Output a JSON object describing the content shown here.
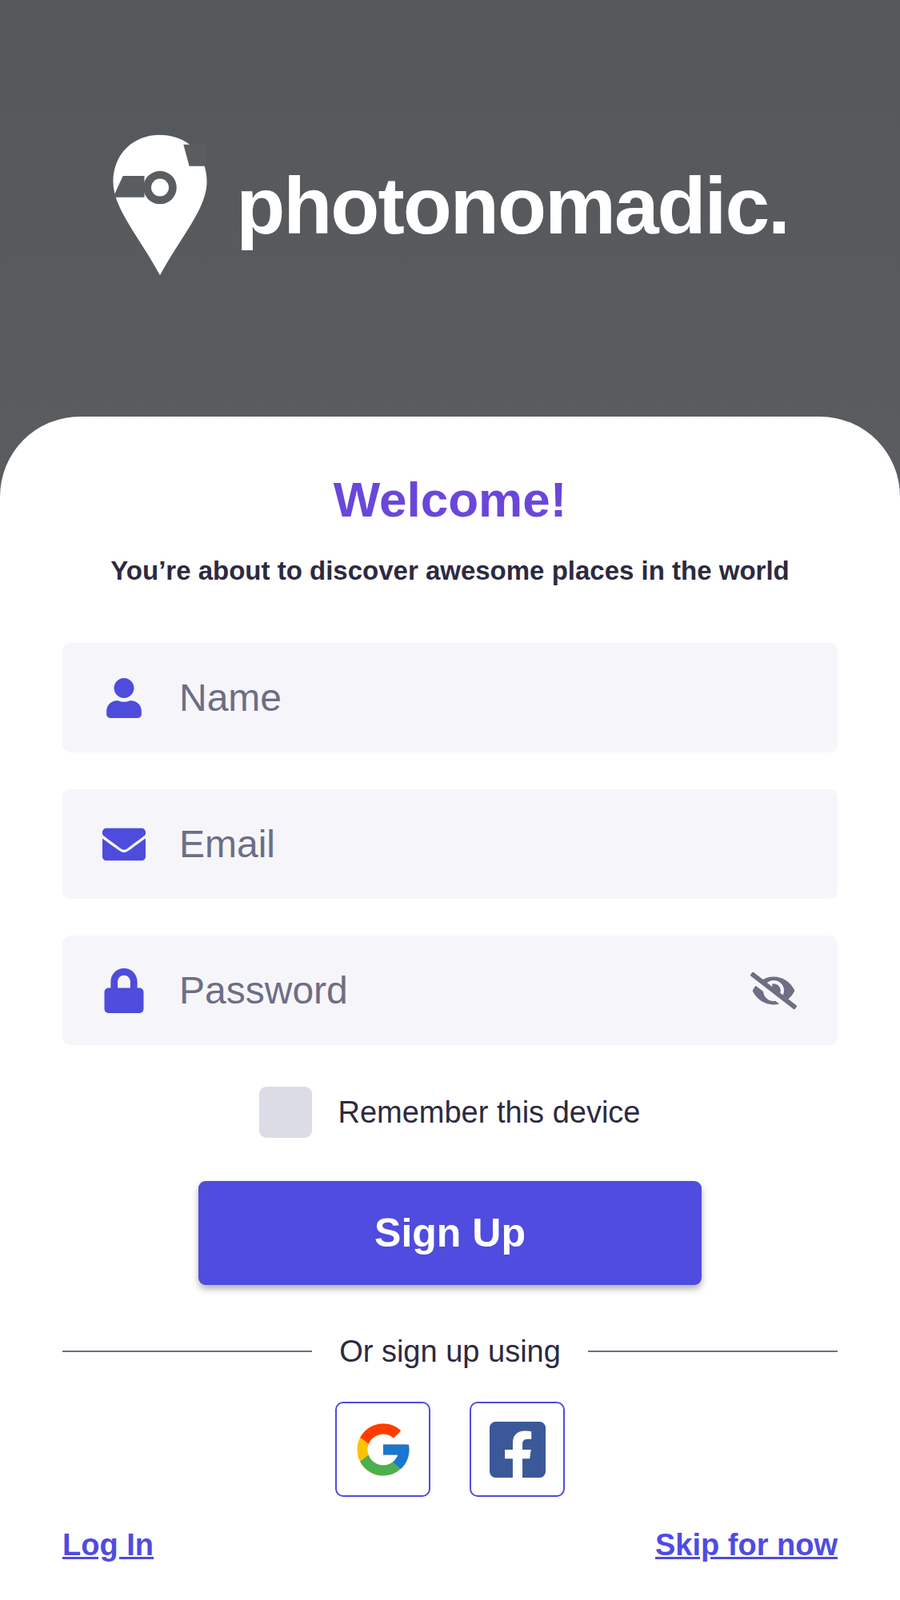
{
  "logo": {
    "text": "photonomadic."
  },
  "welcome": {
    "title": "Welcome!",
    "subtitle": "You’re about to discover awesome places in the world"
  },
  "fields": [
    {
      "kind": "name",
      "placeholder": "Name",
      "value": ""
    },
    {
      "kind": "email",
      "placeholder": "Email",
      "value": ""
    },
    {
      "kind": "password",
      "placeholder": "Password",
      "value": "",
      "password_visible": false
    }
  ],
  "remember": {
    "label": "Remember this device",
    "checked": false
  },
  "submit": {
    "label": "Sign Up"
  },
  "divider": {
    "label": "Or sign up using"
  },
  "social": [
    {
      "kind": "google"
    },
    {
      "kind": "facebook"
    }
  ],
  "links": {
    "login": "Log In",
    "skip": "Skip for now"
  }
}
